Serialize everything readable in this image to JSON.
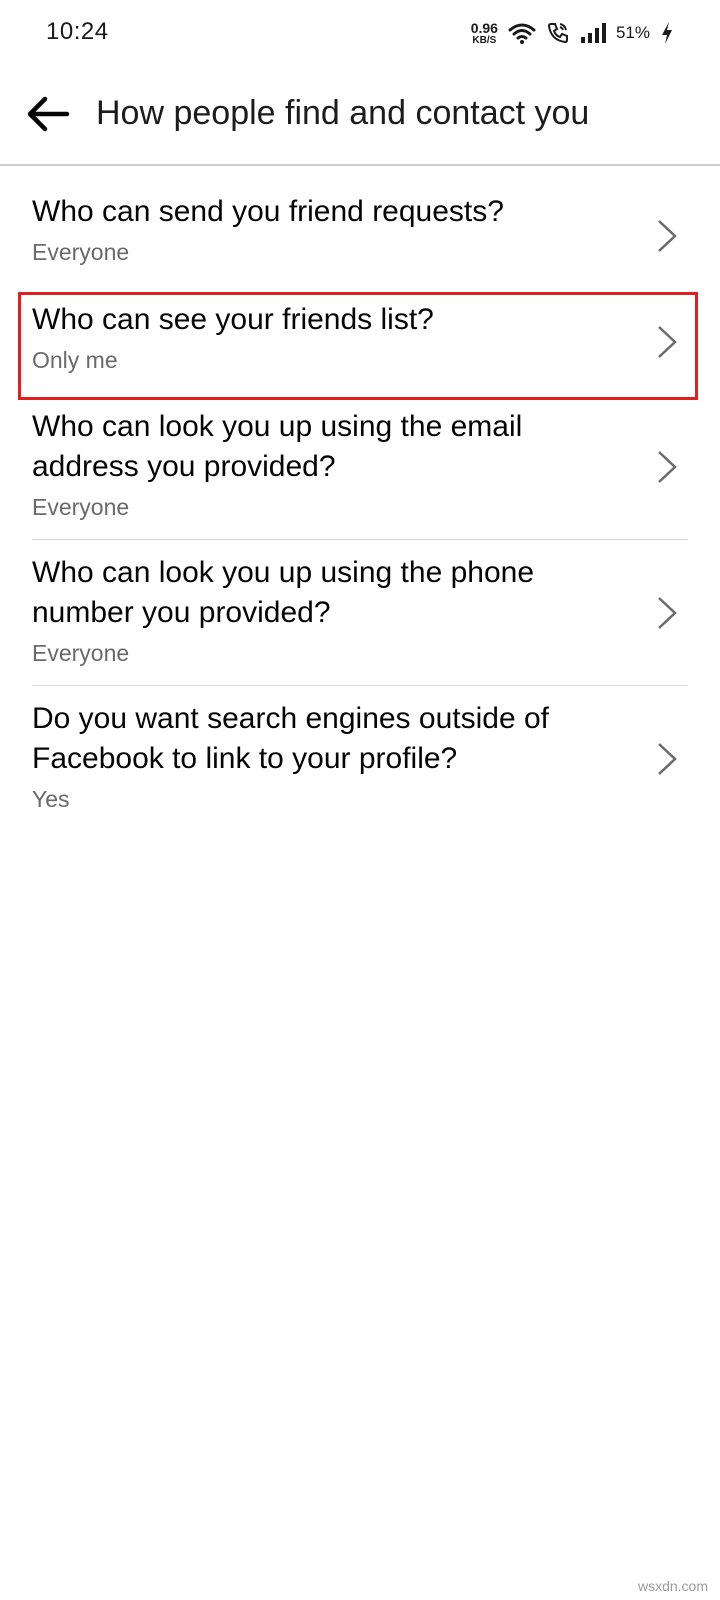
{
  "status_bar": {
    "time": "10:24",
    "net_speed_value": "0.96",
    "net_speed_unit": "KB/S",
    "battery": "51%",
    "icons": [
      "wifi-icon",
      "wifi-calling-icon",
      "signal-icon",
      "charging-icon"
    ]
  },
  "header": {
    "title": "How people find and contact you",
    "back_icon": "back-arrow-icon"
  },
  "settings": [
    {
      "question": "Who can send you friend requests?",
      "answer": "Everyone"
    },
    {
      "question": "Who can see your friends list?",
      "answer": "Only me"
    },
    {
      "question": "Who can look you up using the email address you provided?",
      "answer": "Everyone"
    },
    {
      "question": "Who can look you up using the phone number you provided?",
      "answer": "Everyone"
    },
    {
      "question": "Do you want search engines outside of Facebook to link to your profile?",
      "answer": "Yes"
    }
  ],
  "highlight_color": "#e02020",
  "watermark": "wsxdn.com"
}
